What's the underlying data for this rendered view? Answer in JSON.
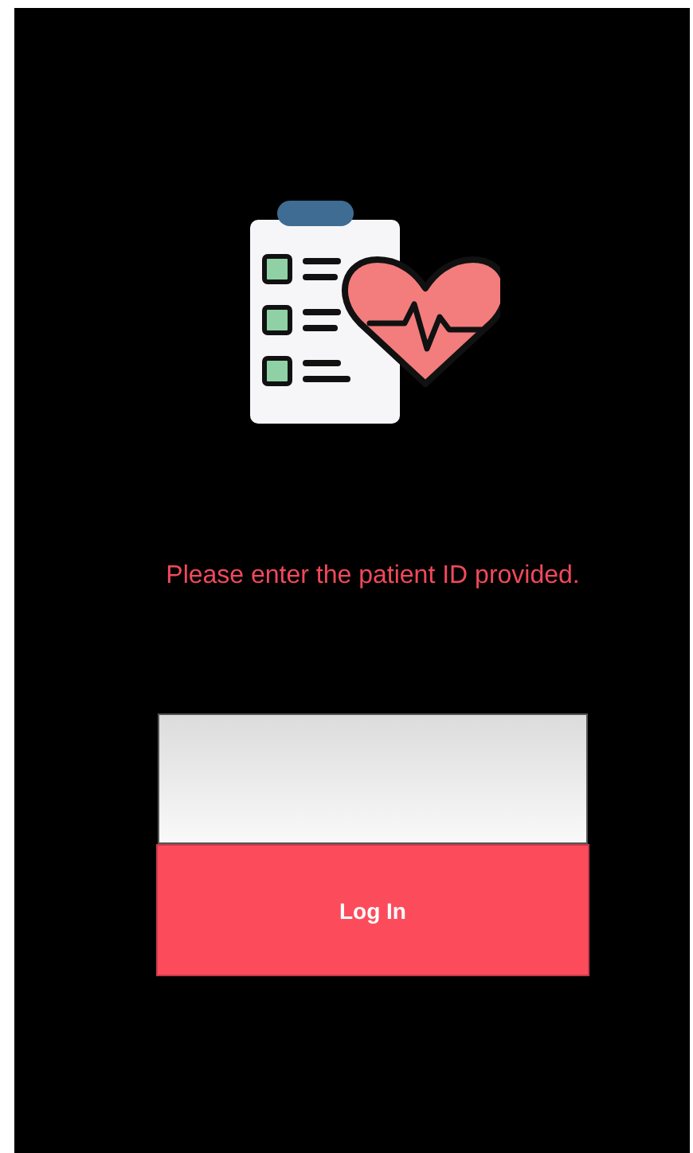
{
  "message": "Please enter the patient ID provided.",
  "login_button": {
    "label": "Log In"
  }
}
